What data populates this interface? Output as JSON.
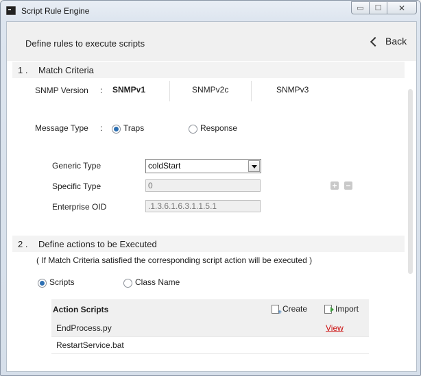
{
  "window": {
    "title": "Script Rule Engine",
    "controls": {
      "minimize": "▭",
      "maximize": "☐",
      "close": "✕"
    }
  },
  "header": {
    "title": "Define rules to execute scripts",
    "back_label": "Back"
  },
  "section1": {
    "number": "1 .",
    "title": "Match Criteria",
    "snmp_label": "SNMP Version",
    "colon": ":",
    "snmp_versions": [
      "SNMPv1",
      "SNMPv2c",
      "SNMPv3"
    ],
    "snmp_selected": "SNMPv1",
    "message_type_label": "Message Type",
    "message_types": [
      "Traps",
      "Response"
    ],
    "message_type_selected": "Traps",
    "generic_type_label": "Generic Type",
    "generic_type_value": "coldStart",
    "specific_type_label": "Specific Type",
    "specific_type_value": "0",
    "enterprise_oid_label": "Enterprise OID",
    "enterprise_oid_value": ".1.3.6.1.6.3.1.1.5.1",
    "plus": "+",
    "minus": "−"
  },
  "section2": {
    "number": "2 .",
    "title": "Define actions to be Executed",
    "note": "( If Match Criteria satisfied the corresponding script action will be executed )",
    "action_types": [
      "Scripts",
      "Class Name"
    ],
    "action_type_selected": "Scripts"
  },
  "action_scripts": {
    "title": "Action Scripts",
    "create_label": "Create",
    "import_label": "Import",
    "rows": [
      {
        "name": "EndProcess.py",
        "action": "View"
      },
      {
        "name": "RestartService.bat",
        "action": ""
      }
    ]
  },
  "colors": {
    "accent": "#2c6fb2",
    "link": "#cc1111"
  }
}
